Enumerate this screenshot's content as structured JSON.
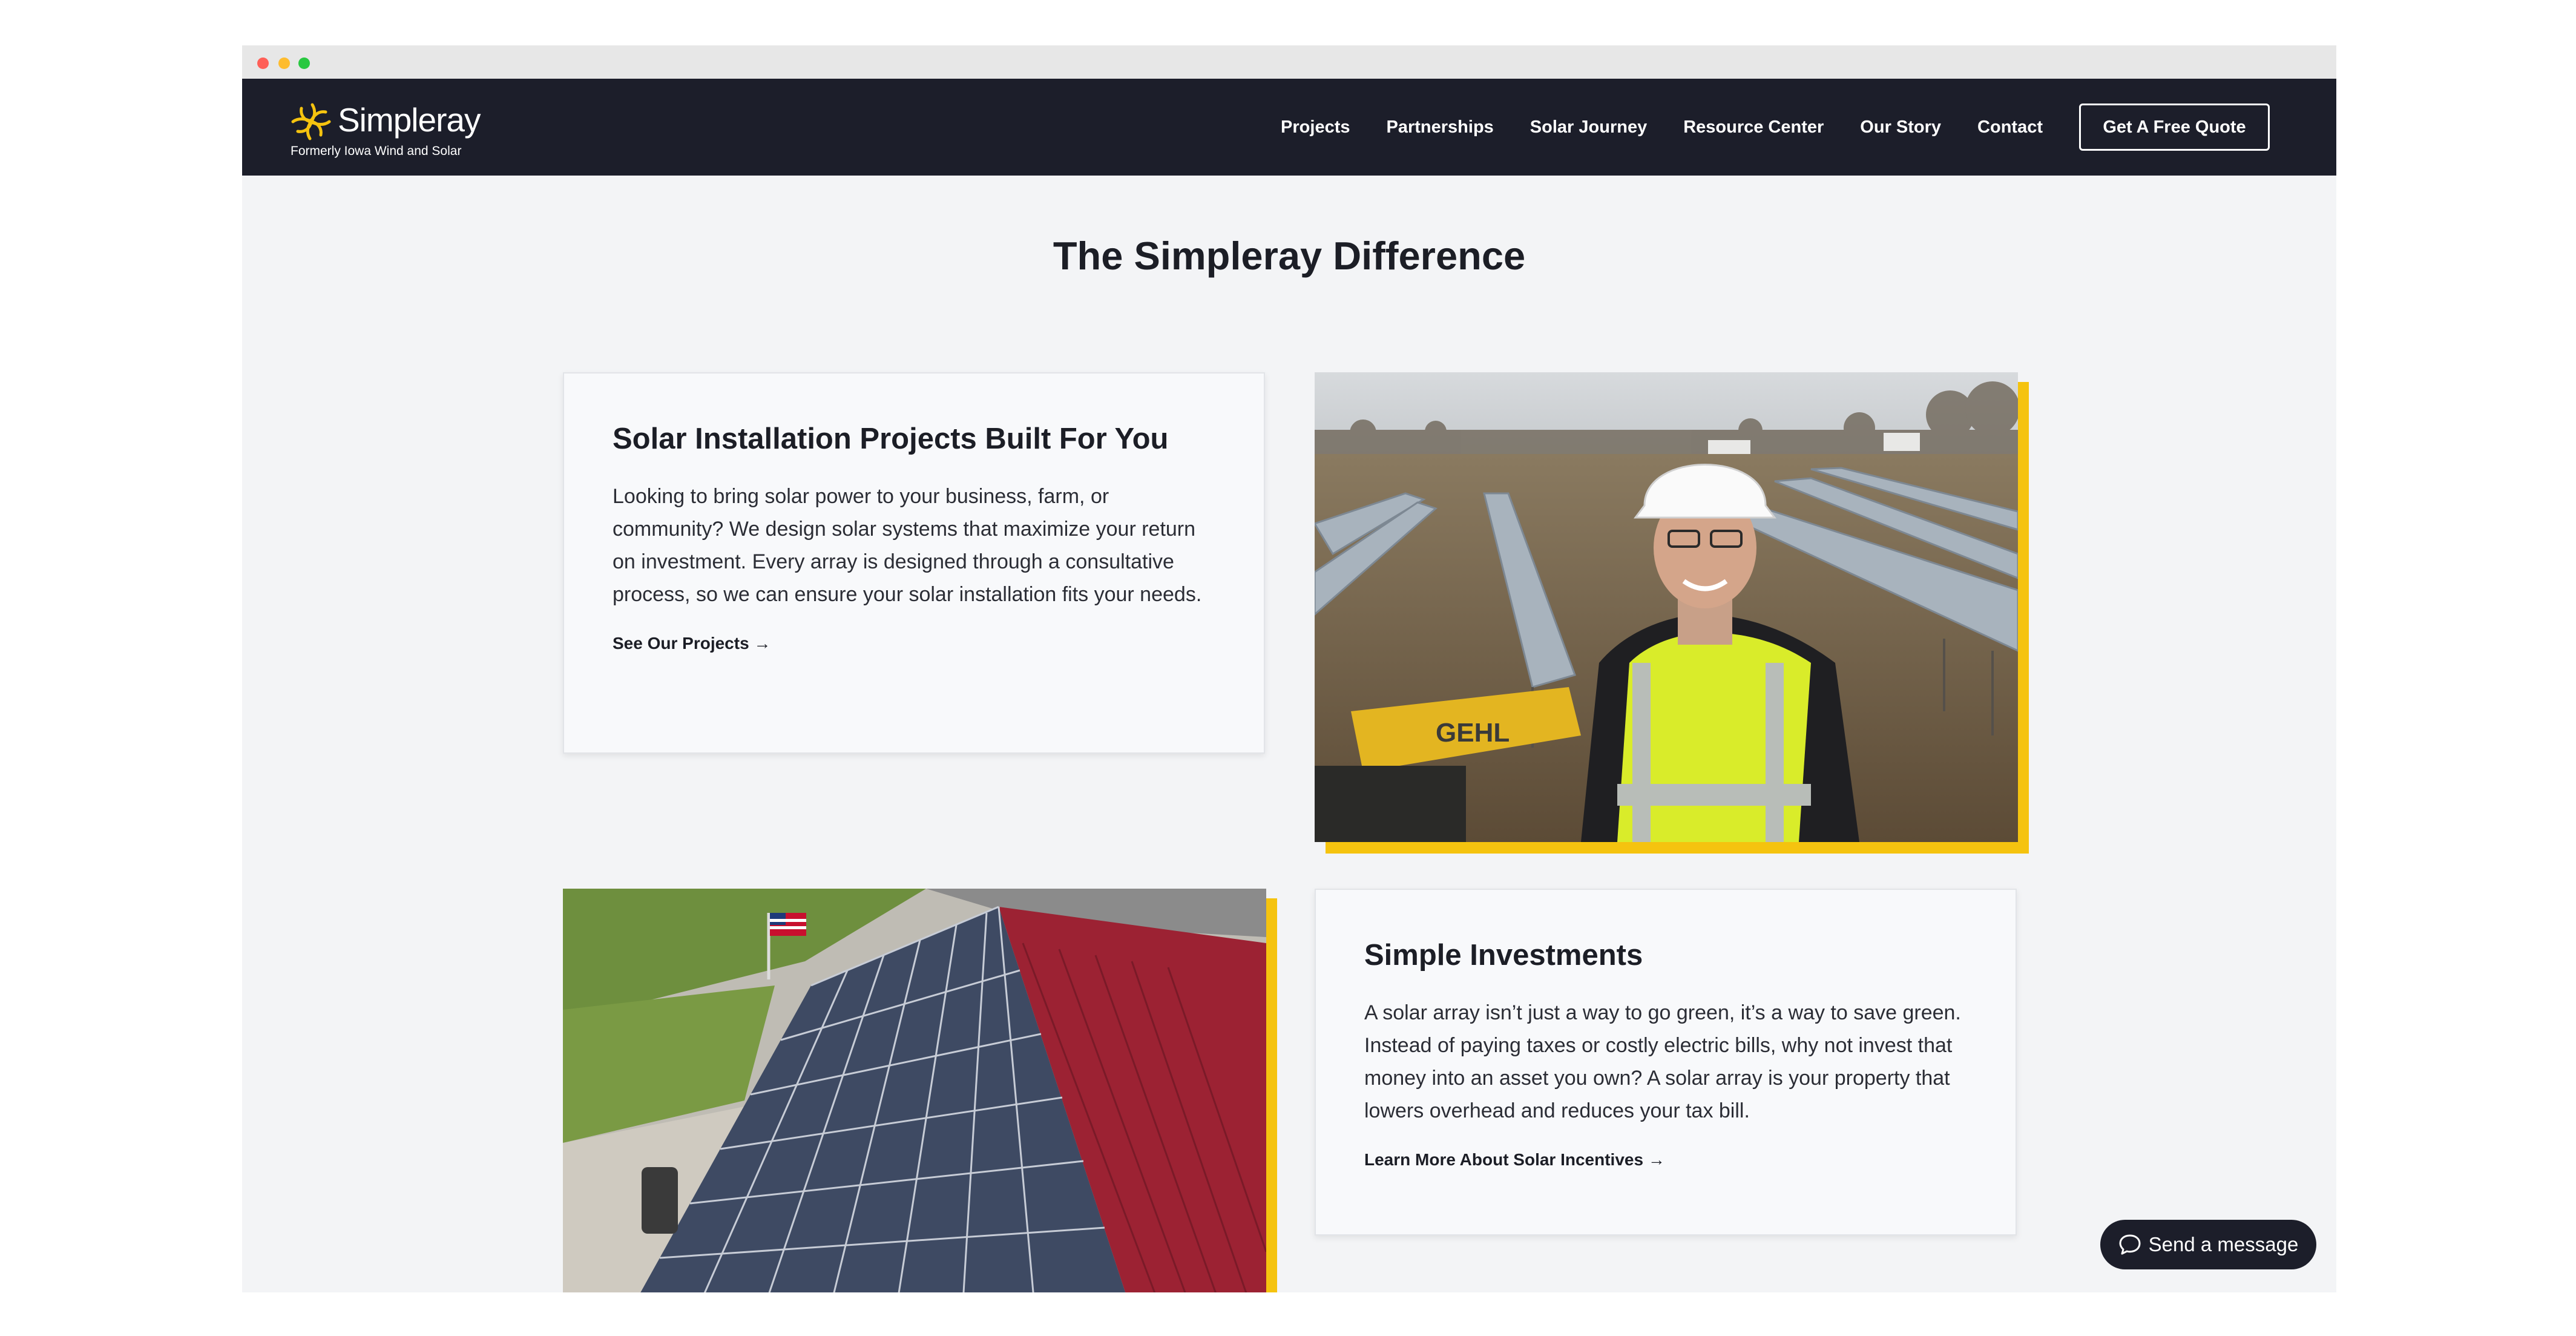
{
  "brand": {
    "name": "Simpleray",
    "tagline": "Formerly Iowa Wind and Solar",
    "accent_color": "#f5c30f",
    "nav_bg_color": "#1c1e2a"
  },
  "nav": {
    "links": [
      "Projects",
      "Partnerships",
      "Solar Journey",
      "Resource Center",
      "Our Story",
      "Contact"
    ],
    "cta_label": "Get A Free Quote"
  },
  "section": {
    "title": "The Simpleray Difference"
  },
  "cards": [
    {
      "heading": "Solar Installation Projects Built For You",
      "body": "Looking to bring solar power to your business, farm, or community? We design solar systems that maximize your return on investment. Every array is designed through a consultative process, so we can ensure your solar installation fits your needs.",
      "link": "See Our Projects →"
    },
    {
      "heading": "Simple Investments",
      "body": "A solar array isn’t just a way to go green, it’s a way to save green. Instead of paying taxes or costly electric bills, why not invest that money into an asset you own? A solar array is your property that lowers overhead and reduces your tax bill.",
      "link": "Learn More About Solar Incentives →"
    }
  ],
  "photos": [
    {
      "subject": "worker-in-solar-field"
    },
    {
      "subject": "rooftop-solar-panels"
    }
  ],
  "chat": {
    "label": "Send a message",
    "icon": "chat-bubble-icon"
  }
}
